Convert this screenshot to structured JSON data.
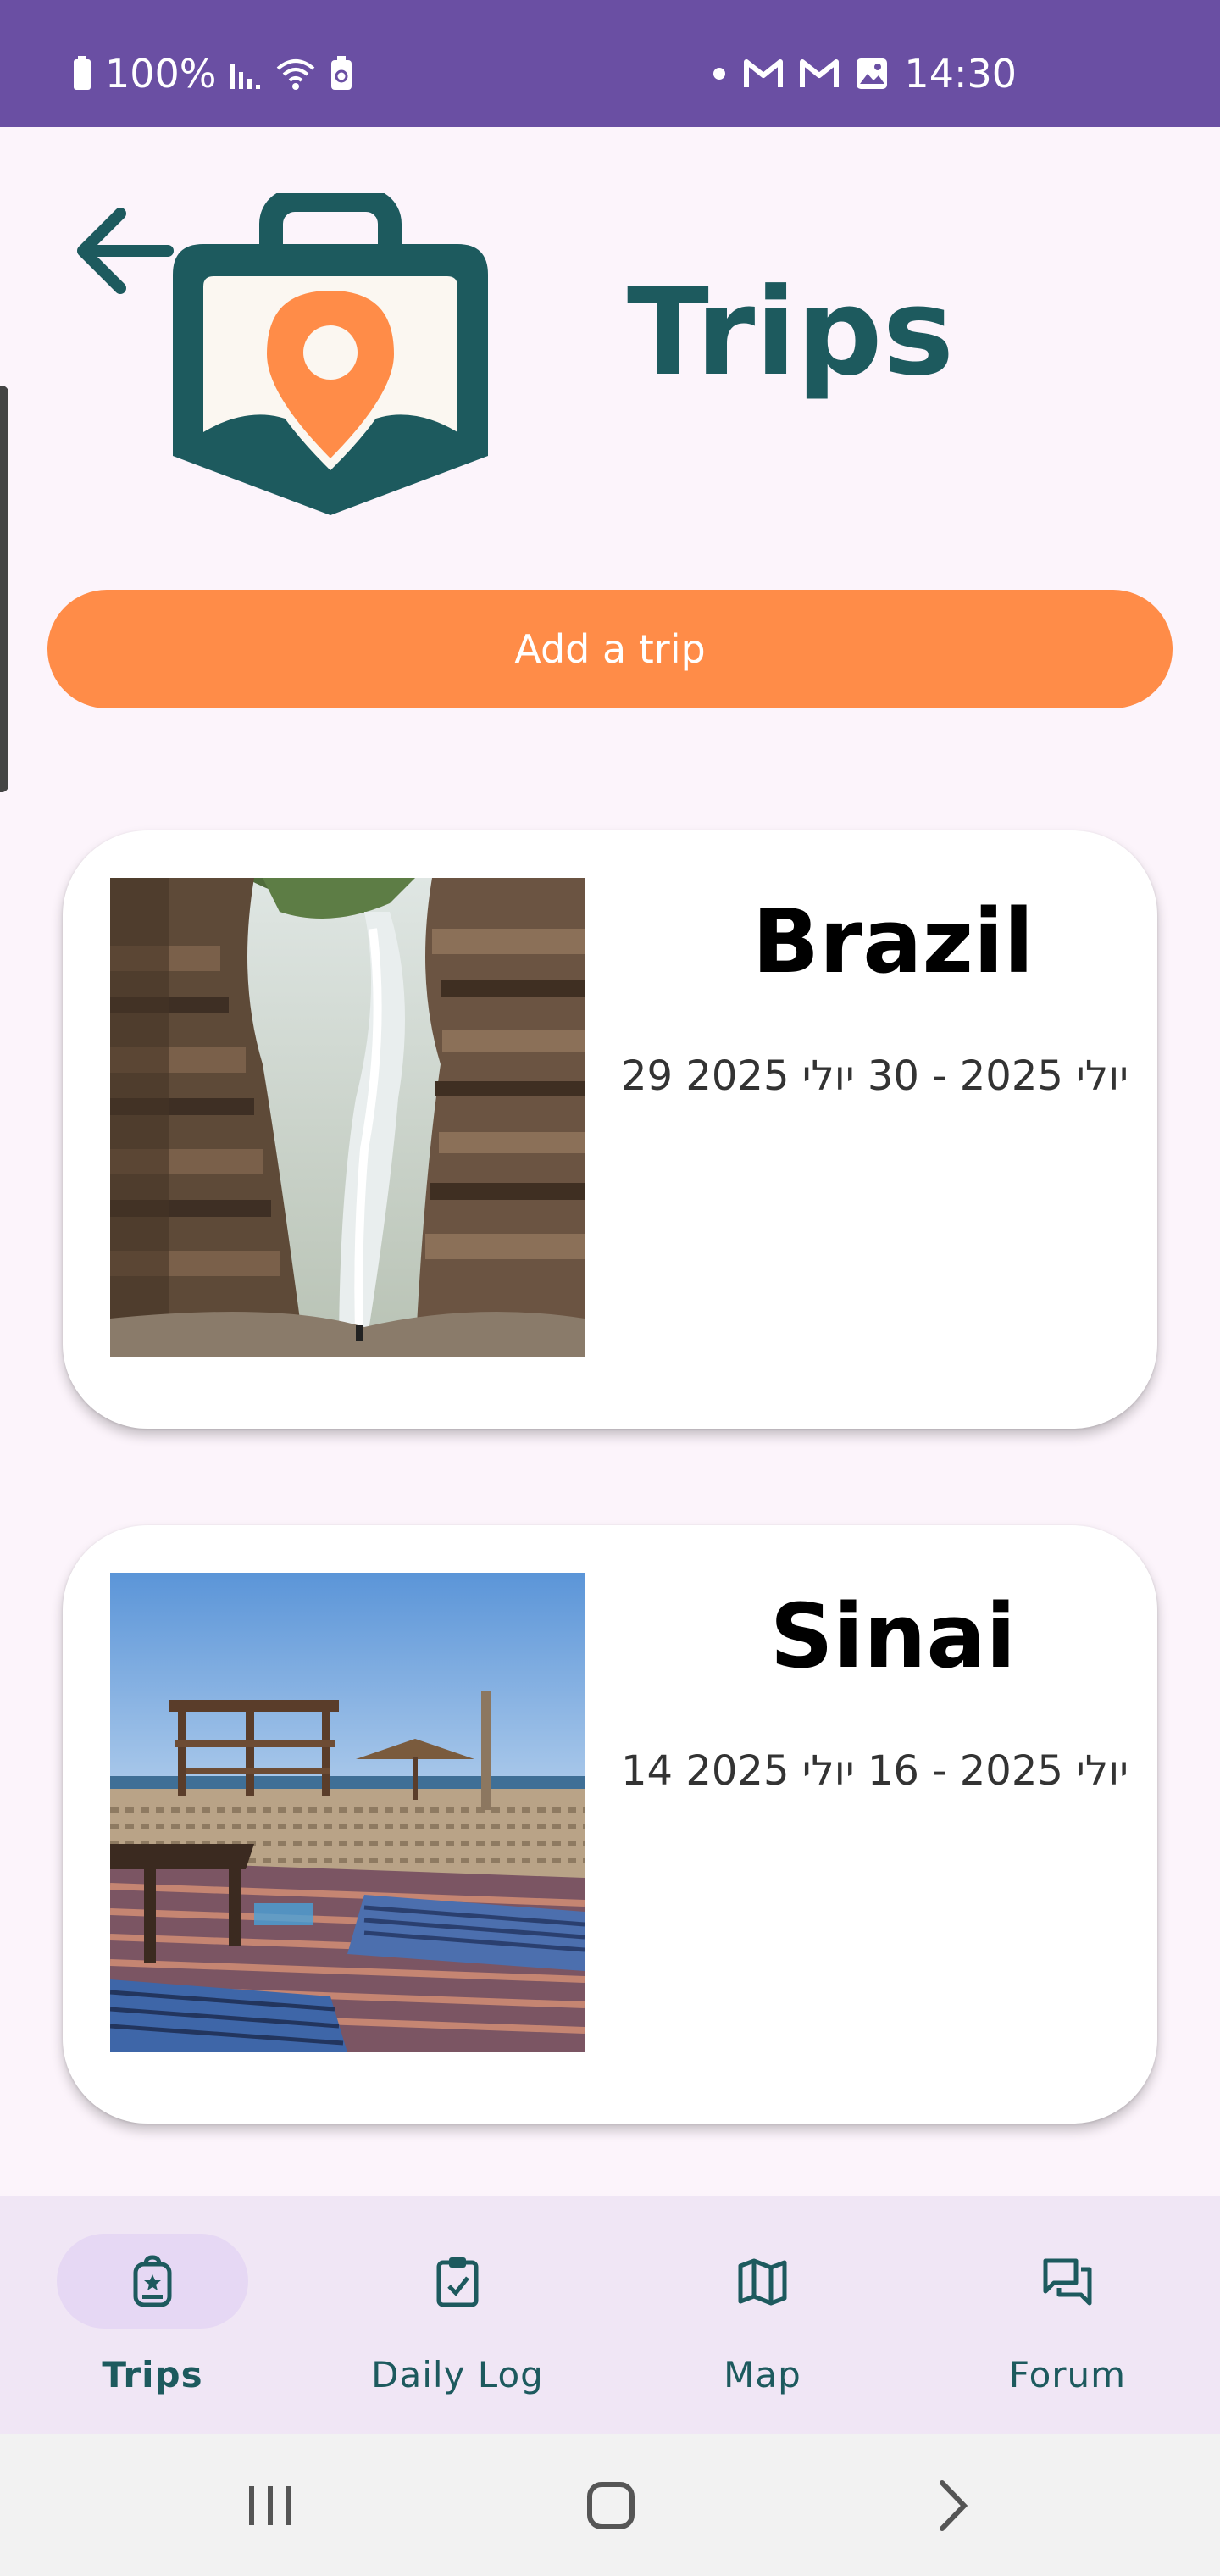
{
  "status_bar": {
    "battery": "100%",
    "time": "14:30",
    "icons_left": [
      "battery-icon",
      "signal-icon",
      "wifi-icon",
      "battery-saver-icon"
    ],
    "icons_right": [
      "dot-icon",
      "gmail-icon",
      "gmail-icon",
      "gallery-icon"
    ]
  },
  "header": {
    "title": "Trips",
    "back_icon": "arrow-left-icon",
    "logo_icon": "suitcase-map-pin-logo"
  },
  "actions": {
    "add_trip_label": "Add a trip"
  },
  "trips": [
    {
      "name": "Brazil",
      "dates": "29 יולי 2025 - 30 יולי 2025",
      "photo": "waterfall-photo"
    },
    {
      "name": "Sinai",
      "dates": "14 יולי 2025 - 16 יולי 2025",
      "photo": "beach-camp-photo"
    }
  ],
  "bottom_nav": {
    "items": [
      {
        "label": "Trips",
        "icon": "backpack-icon",
        "active": true
      },
      {
        "label": "Daily Log",
        "icon": "clipboard-check-icon",
        "active": false
      },
      {
        "label": "Map",
        "icon": "map-icon",
        "active": false
      },
      {
        "label": "Forum",
        "icon": "forum-icon",
        "active": false
      }
    ]
  },
  "system_nav": {
    "buttons": [
      "recents-icon",
      "home-icon",
      "back-chevron-icon"
    ]
  },
  "colors": {
    "status_bar": "#6a4fa3",
    "accent_orange": "#ff8c48",
    "teal": "#1d5a5e",
    "background": "#fcf4fb",
    "nav_background": "#f0e6f5",
    "nav_active_pill": "#e6d8f4"
  }
}
